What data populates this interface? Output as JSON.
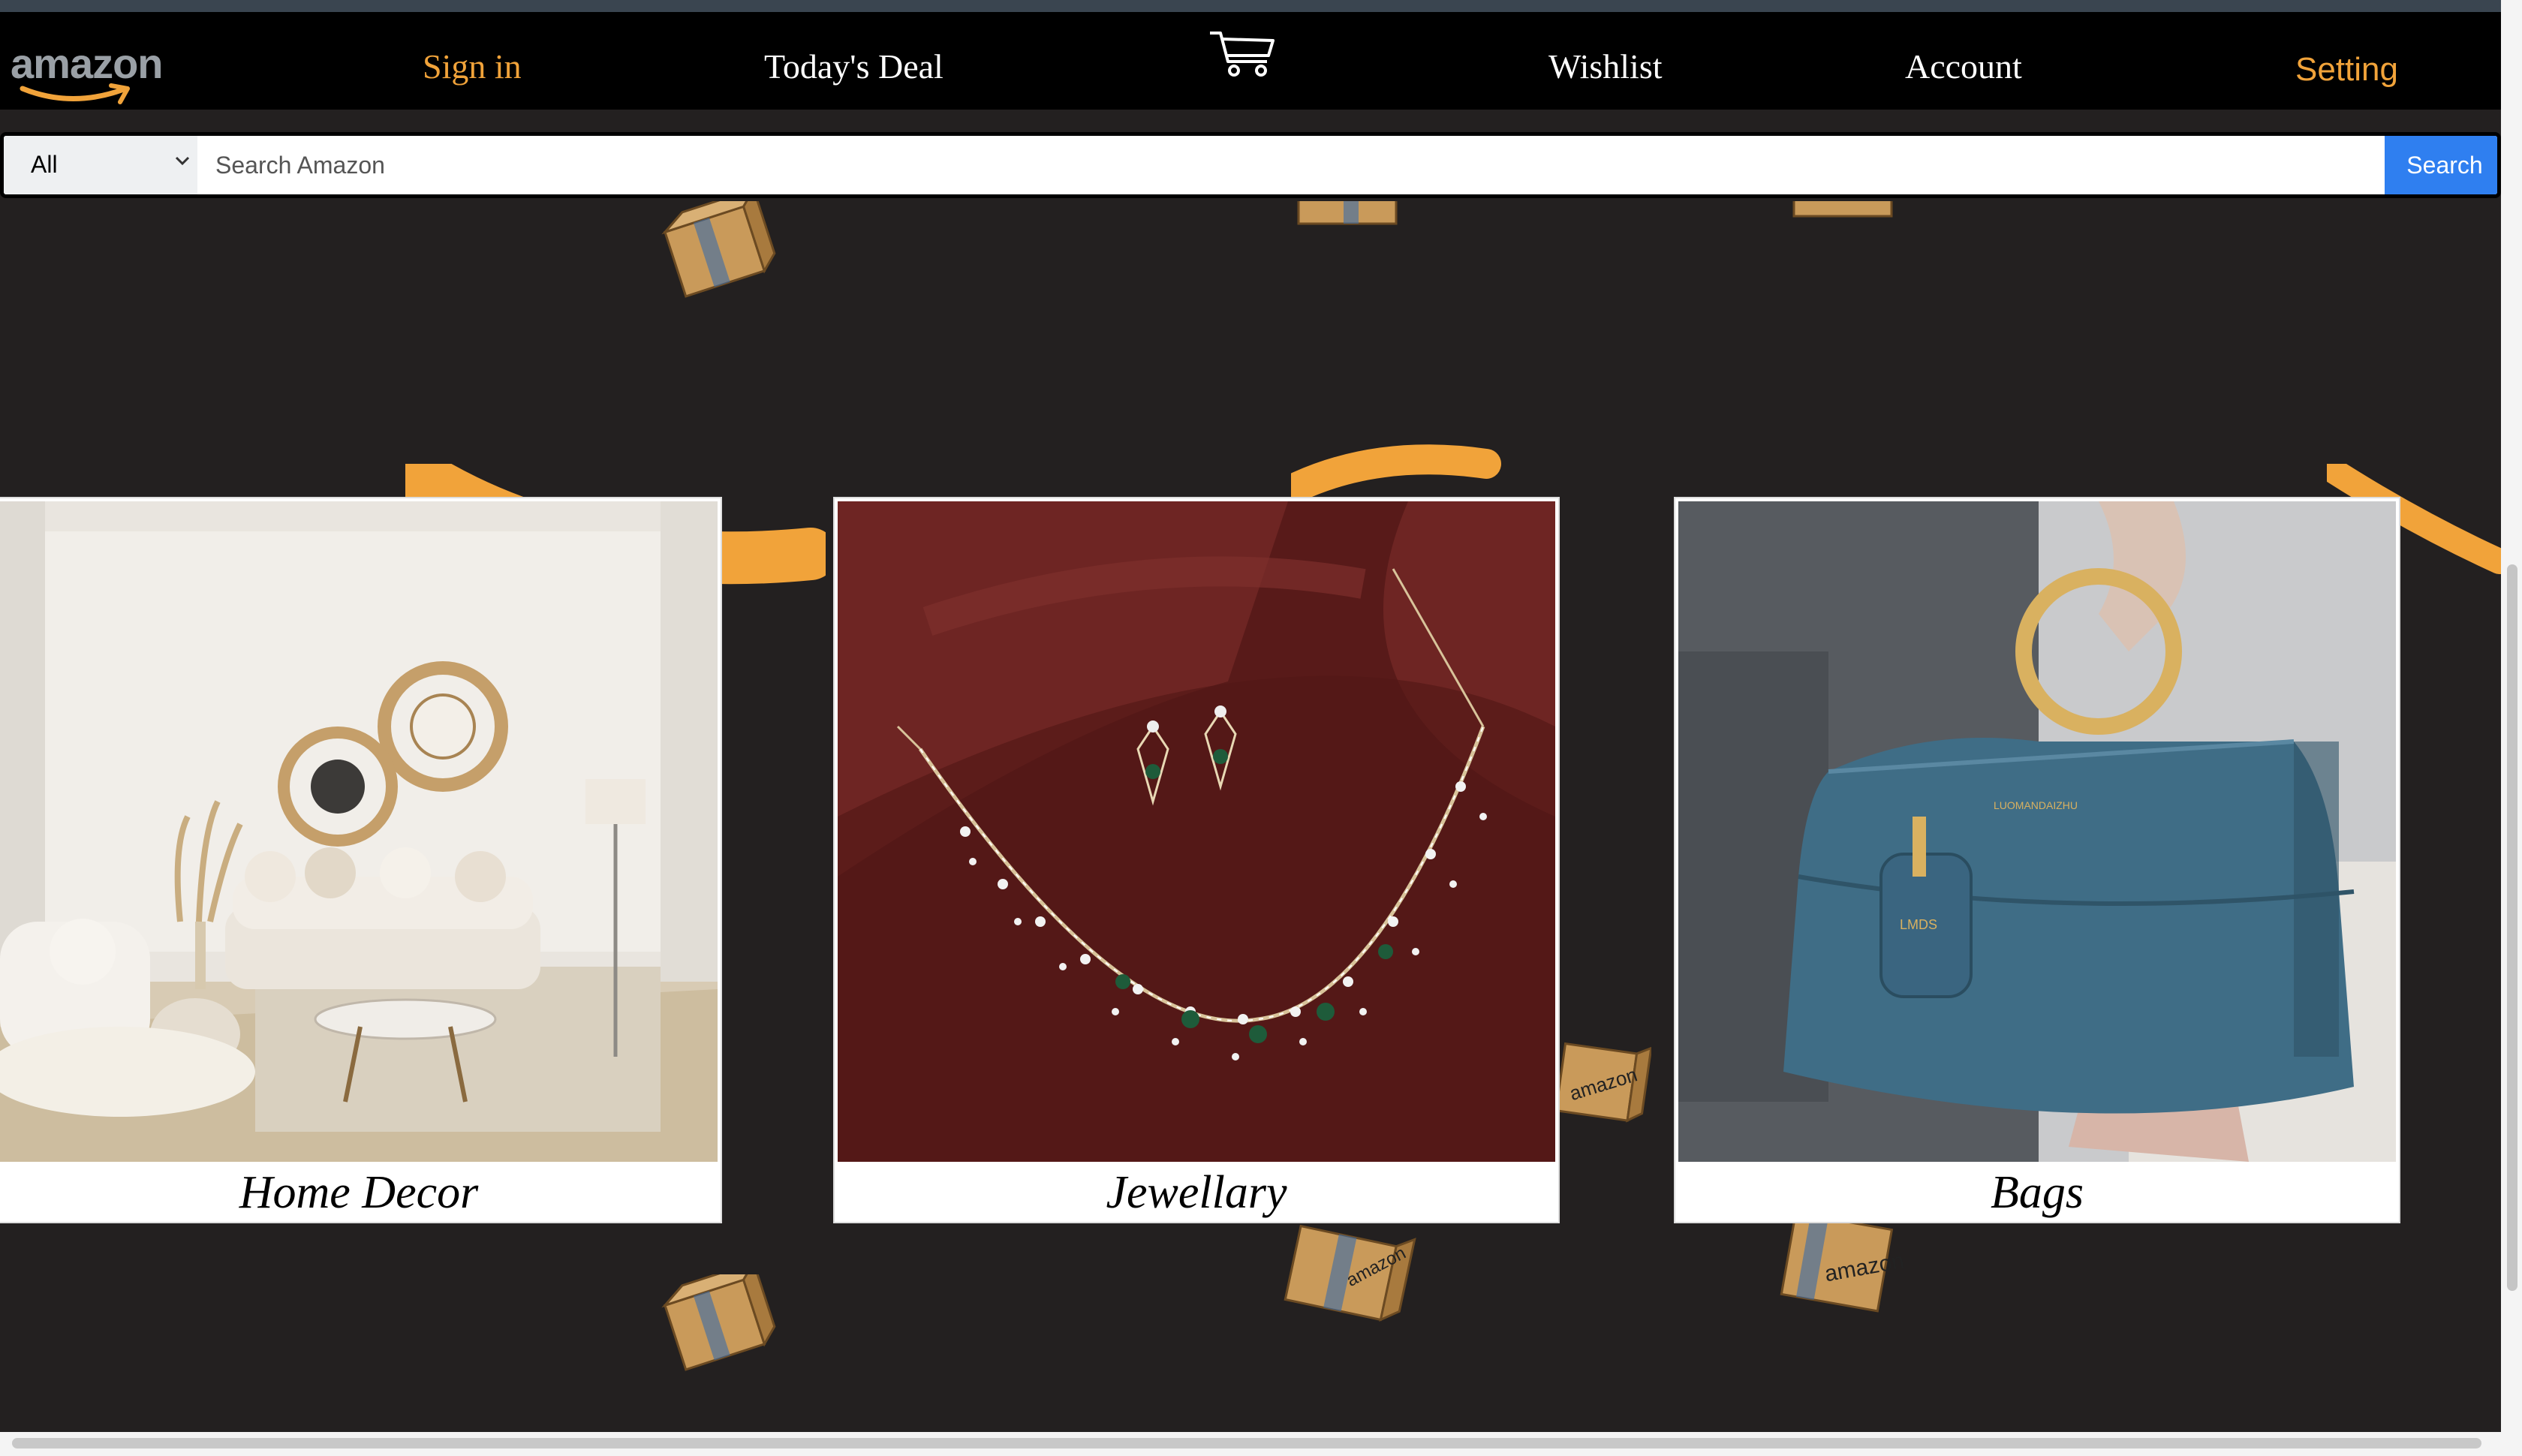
{
  "colors": {
    "accent": "#f1a33a",
    "nav_bg": "#000000",
    "page_bg": "#232020",
    "search_button": "#2f7ff0"
  },
  "nav": {
    "logo_text": "amazon",
    "sign_in": "Sign in",
    "todays_deal": "Today's Deal",
    "cart_icon": "shopping-cart-icon",
    "wishlist": "Wishlist",
    "account": "Account",
    "setting": "Setting"
  },
  "search": {
    "category": "All",
    "placeholder": "Search Amazon",
    "button": "Search"
  },
  "cards": [
    {
      "caption": "Home Decor"
    },
    {
      "caption": "Jewellary"
    },
    {
      "caption": "Bags"
    }
  ]
}
